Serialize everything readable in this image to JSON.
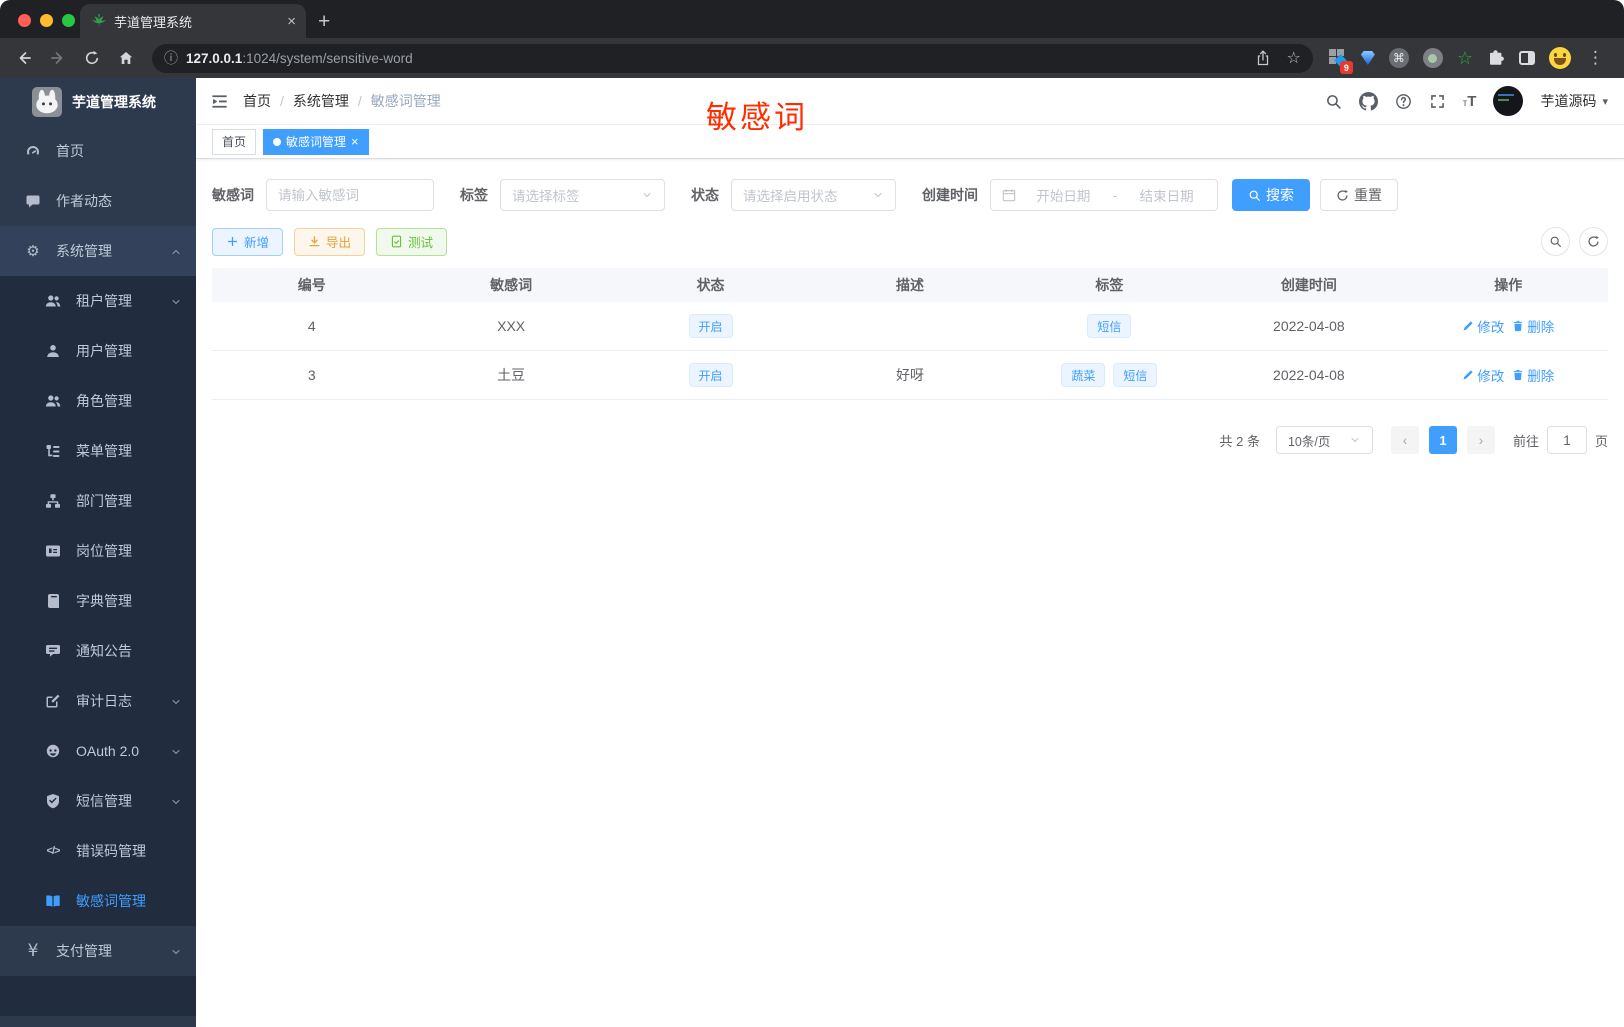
{
  "browser": {
    "tab_title": "芋道管理系统",
    "url_host": "127.0.0.1",
    "url_path": ":1024/system/sensitive-word",
    "extension_badge": "9"
  },
  "icons": {
    "plus": "+",
    "close": "×",
    "info": "ⓘ",
    "star": "☆",
    "kebab": "⋮",
    "command": "⌘",
    "gear": "⚙",
    "yen": "¥",
    "code": "</>",
    "question": "?",
    "caret": "▾",
    "prev": "‹",
    "next": "›",
    "t_large": "T",
    "t_small": "т"
  },
  "annotation": {
    "text": "敏感词",
    "color": "#ff2d00"
  },
  "sidebar": {
    "title": "芋道管理系统",
    "items": [
      {
        "label": "首页"
      },
      {
        "label": "作者动态"
      },
      {
        "label": "系统管理"
      },
      {
        "label": "租户管理"
      },
      {
        "label": "用户管理"
      },
      {
        "label": "角色管理"
      },
      {
        "label": "菜单管理"
      },
      {
        "label": "部门管理"
      },
      {
        "label": "岗位管理"
      },
      {
        "label": "字典管理"
      },
      {
        "label": "通知公告"
      },
      {
        "label": "审计日志"
      },
      {
        "label": "OAuth 2.0"
      },
      {
        "label": "短信管理"
      },
      {
        "label": "错误码管理"
      },
      {
        "label": "敏感词管理"
      },
      {
        "label": "支付管理"
      }
    ]
  },
  "header": {
    "breadcrumb": [
      "首页",
      "系统管理",
      "敏感词管理"
    ],
    "breadcrumb_separator": "/",
    "username": "芋道源码"
  },
  "tags_view": [
    {
      "label": "首页"
    },
    {
      "label": "敏感词管理"
    }
  ],
  "filters": {
    "keyword_label": "敏感词",
    "keyword_placeholder": "请输入敏感词",
    "tag_label": "标签",
    "tag_placeholder": "请选择标签",
    "status_label": "状态",
    "status_placeholder": "请选择启用状态",
    "time_label": "创建时间",
    "time_start_placeholder": "开始日期",
    "time_separator": "-",
    "time_end_placeholder": "结束日期",
    "search_label": "搜索",
    "reset_label": "重置"
  },
  "toolbar": {
    "add_label": "新增",
    "export_label": "导出",
    "test_label": "测试"
  },
  "table": {
    "headers": [
      "编号",
      "敏感词",
      "状态",
      "描述",
      "标签",
      "创建时间",
      "操作"
    ],
    "ops": {
      "edit": "修改",
      "delete": "删除"
    },
    "rows": [
      {
        "id": "4",
        "word": "XXX",
        "status": "开启",
        "description": "",
        "tags": [
          "短信"
        ],
        "create_time": "2022-04-08"
      },
      {
        "id": "3",
        "word": "土豆",
        "status": "开启",
        "description": "好呀",
        "tags": [
          "蔬菜",
          "短信"
        ],
        "create_time": "2022-04-08"
      }
    ]
  },
  "pagination": {
    "total": "共 2 条",
    "page_size": "10条/页",
    "current_page": "1",
    "goto_label": "前往",
    "page_unit": "页"
  },
  "colors": {
    "primary": "#409eff",
    "sidebar_bg": "#2d3a4e",
    "submenu_bg": "#212d3f",
    "annotation_red": "#ff2d00"
  }
}
